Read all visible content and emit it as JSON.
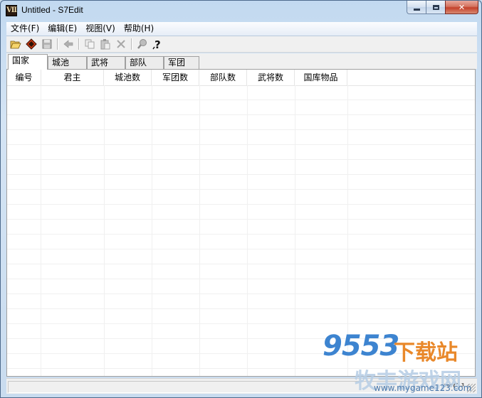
{
  "window": {
    "title": "Untitled - S7Edit",
    "icon_text": "VII"
  },
  "menu": [
    {
      "label": "文件(F)"
    },
    {
      "label": "编辑(E)"
    },
    {
      "label": "视图(V)"
    },
    {
      "label": "帮助(H)"
    }
  ],
  "toolbar": {
    "icons": [
      "open-folder-icon",
      "tag-icon",
      "save-icon",
      "back-arrow-icon",
      "copy-icon",
      "paste-icon",
      "delete-icon",
      "find-icon",
      "help-icon"
    ]
  },
  "tabs": [
    {
      "label": "国家",
      "active": true
    },
    {
      "label": "城池"
    },
    {
      "label": "武将"
    },
    {
      "label": "部队"
    },
    {
      "label": "军团"
    }
  ],
  "list": {
    "columns": [
      "编号",
      "君主",
      "城池数",
      "军团数",
      "部队数",
      "武将数",
      "国库物品"
    ],
    "rows": []
  },
  "status": {
    "right_text": "ᵃᵘᵉC·³"
  },
  "watermark": {
    "logo_number": "9553",
    "logo_text": "下载站",
    "site_name": "牧丰游戏网",
    "url": "www.mygame123.com"
  },
  "colors": {
    "accent": "#3d84d0",
    "close_button": "#c4402a"
  }
}
